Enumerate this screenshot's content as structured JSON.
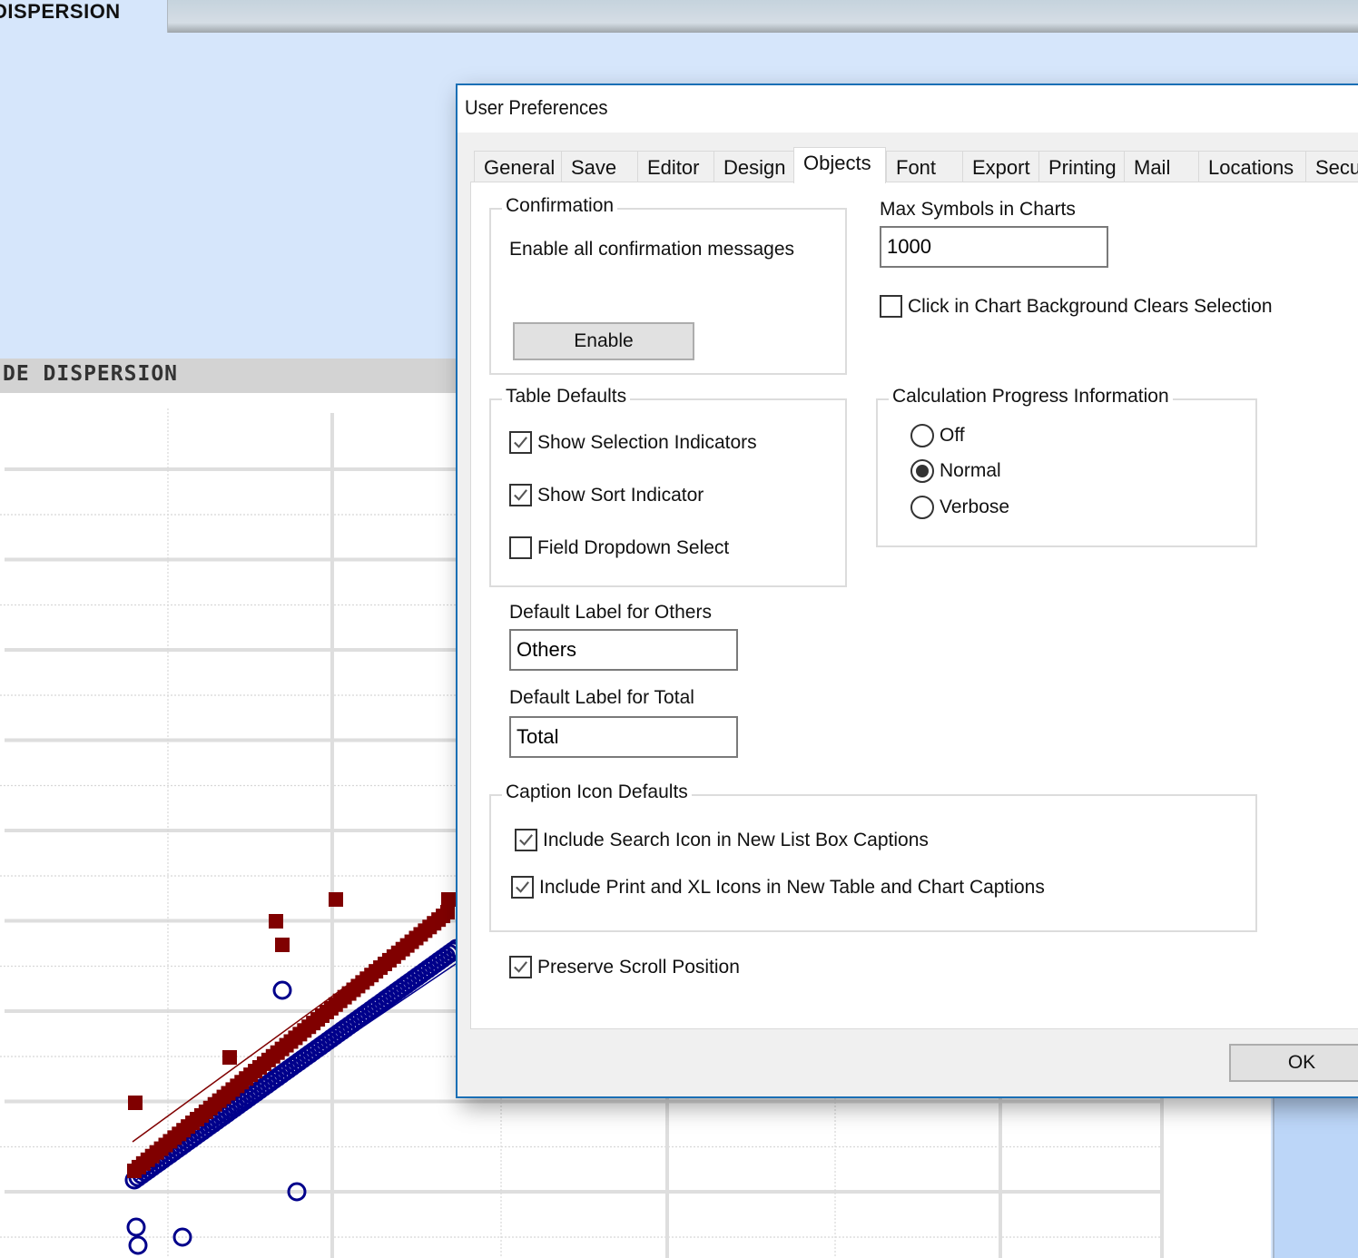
{
  "app": {
    "top_tab_label": "DISPERSION",
    "chart_title": "DE DISPERSION"
  },
  "chart_data": {
    "type": "scatter",
    "title": "DE DISPERSION",
    "xlabel": "",
    "ylabel": "",
    "grid": true,
    "series": [
      {
        "name": "series-red-squares",
        "marker": "square",
        "color": "#800000"
      },
      {
        "name": "series-blue-circles",
        "marker": "open-circle",
        "color": "#00008b"
      }
    ],
    "note": "Axis labels and tick values are not visible; chart partially hidden behind dialog."
  },
  "colors": {
    "accent": "#1a6fb5",
    "series_red": "#800000",
    "series_blue": "#00008b",
    "chart_title_bar": "#d3d3d3"
  },
  "dialog": {
    "title": "User Preferences",
    "tabs": [
      {
        "label": "General",
        "active": false
      },
      {
        "label": "Save",
        "active": false
      },
      {
        "label": "Editor",
        "active": false
      },
      {
        "label": "Design",
        "active": false
      },
      {
        "label": "Objects",
        "active": true
      },
      {
        "label": "Font",
        "active": false
      },
      {
        "label": "Export",
        "active": false
      },
      {
        "label": "Printing",
        "active": false
      },
      {
        "label": "Mail",
        "active": false
      },
      {
        "label": "Locations",
        "active": false
      },
      {
        "label": "Secu",
        "active": false
      }
    ],
    "confirmation": {
      "legend": "Confirmation",
      "description": "Enable all confirmation messages",
      "enable_button": "Enable"
    },
    "max_symbols": {
      "label": "Max Symbols in Charts",
      "value": "1000"
    },
    "click_bg_clears": {
      "label": "Click in Chart Background Clears Selection",
      "checked": false
    },
    "table_defaults": {
      "legend": "Table Defaults",
      "items": [
        {
          "label": "Show Selection Indicators",
          "checked": true
        },
        {
          "label": "Show Sort Indicator",
          "checked": true
        },
        {
          "label": "Field Dropdown Select",
          "checked": false
        }
      ]
    },
    "calc_progress": {
      "legend": "Calculation Progress Information",
      "options": [
        {
          "label": "Off",
          "selected": false
        },
        {
          "label": "Normal",
          "selected": true
        },
        {
          "label": "Verbose",
          "selected": false
        }
      ]
    },
    "others_label": {
      "label": "Default Label for Others",
      "value": "Others"
    },
    "total_label": {
      "label": "Default Label for Total",
      "value": "Total"
    },
    "caption_icons": {
      "legend": "Caption Icon Defaults",
      "items": [
        {
          "label": "Include Search Icon in New List Box Captions",
          "checked": true
        },
        {
          "label": "Include Print and XL Icons in New Table and Chart Captions",
          "checked": true
        }
      ]
    },
    "preserve_scroll": {
      "label": "Preserve Scroll Position",
      "checked": true
    },
    "ok_button": "OK"
  }
}
